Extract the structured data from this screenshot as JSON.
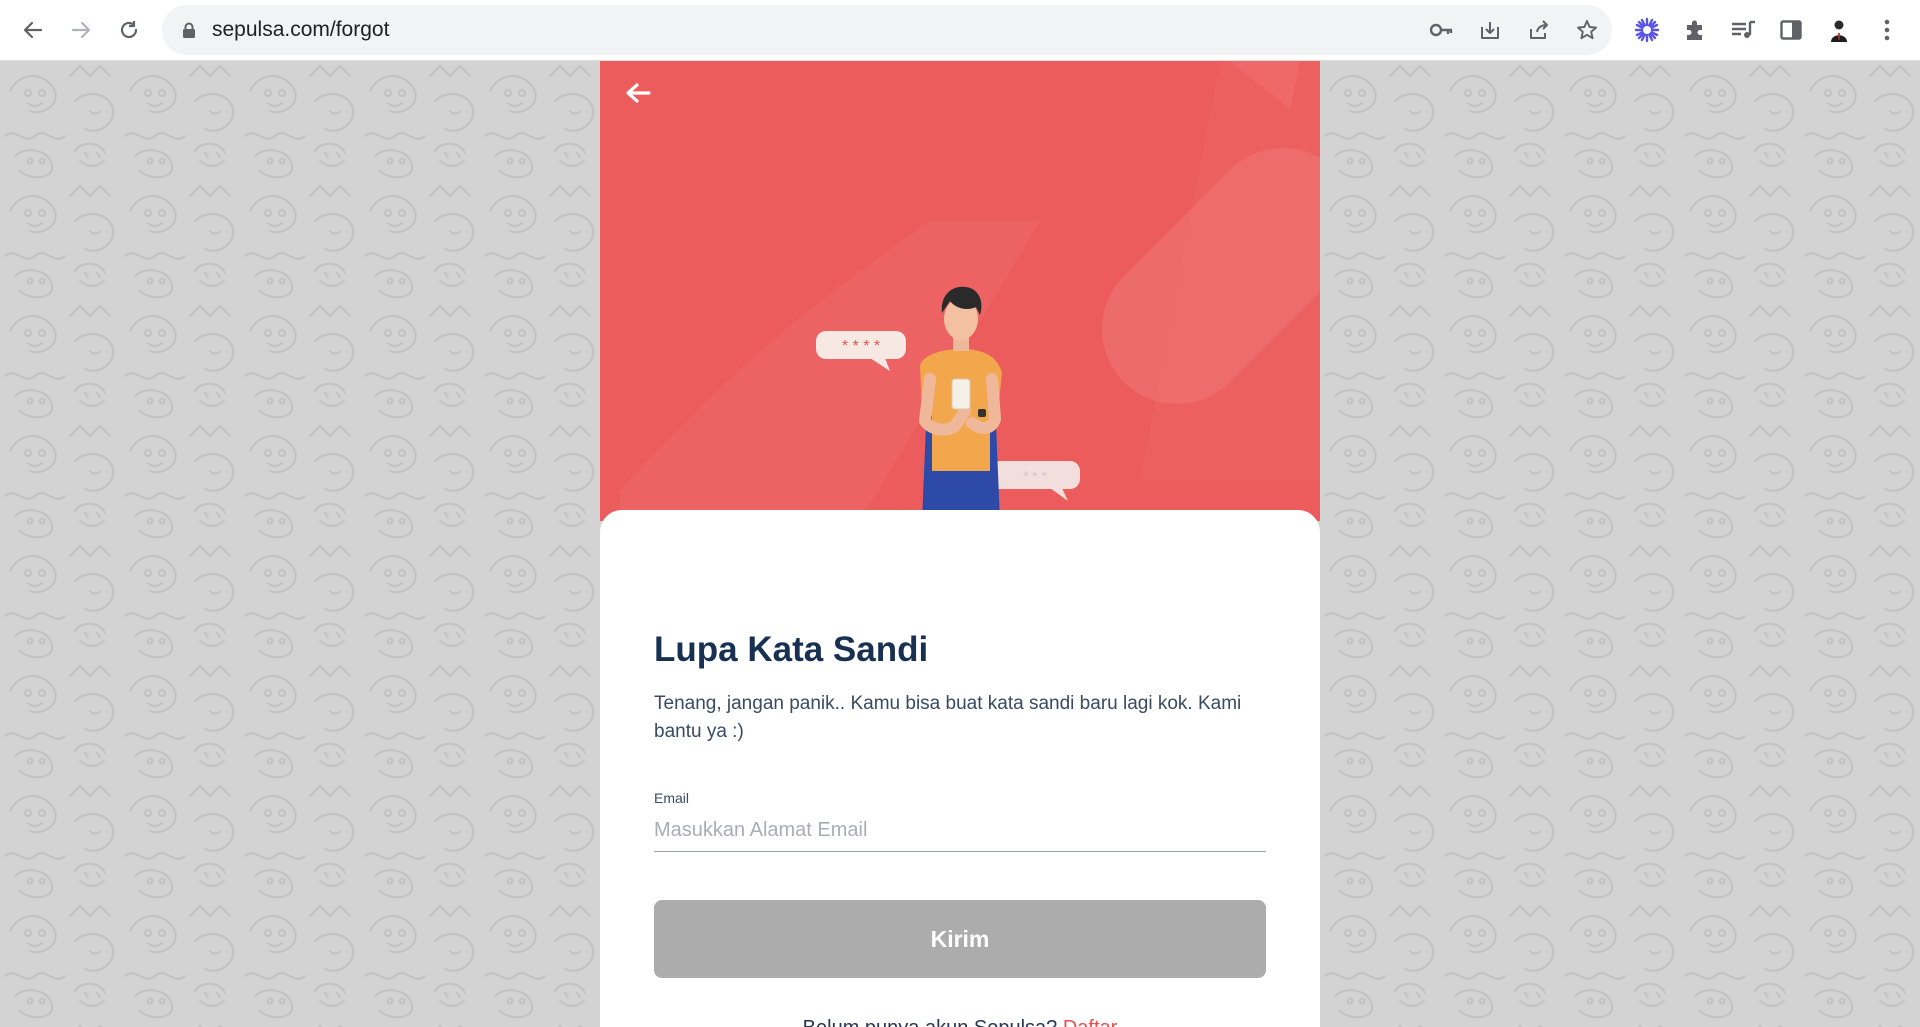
{
  "browser": {
    "url": "sepulsa.com/forgot",
    "icons": [
      "back-icon",
      "forward-icon",
      "reload-icon",
      "lock-icon",
      "key-icon",
      "install-icon",
      "share-icon",
      "star-icon",
      "extension-spark-icon",
      "puzzle-icon",
      "media-icon",
      "sidepanel-icon",
      "profile-avatar",
      "more-icon"
    ]
  },
  "page": {
    "title": "Lupa Kata Sandi",
    "description": "Tenang, jangan panik.. Kamu bisa buat kata sandi baru lagi kok. Kami bantu ya :)",
    "email_label": "Email",
    "email_placeholder": "Masukkan Alamat Email",
    "email_value": "",
    "submit_label": "Kirim",
    "signup_text": "Belum punya akun Sepulsa?",
    "signup_link": "Daftar",
    "hero_bubble_1": "* * * *",
    "hero_bubble_2": "* * *"
  },
  "colors": {
    "hero": "#ec5c5c",
    "accent": "#e8504f",
    "button_disabled": "#acacac",
    "title": "#183153"
  }
}
